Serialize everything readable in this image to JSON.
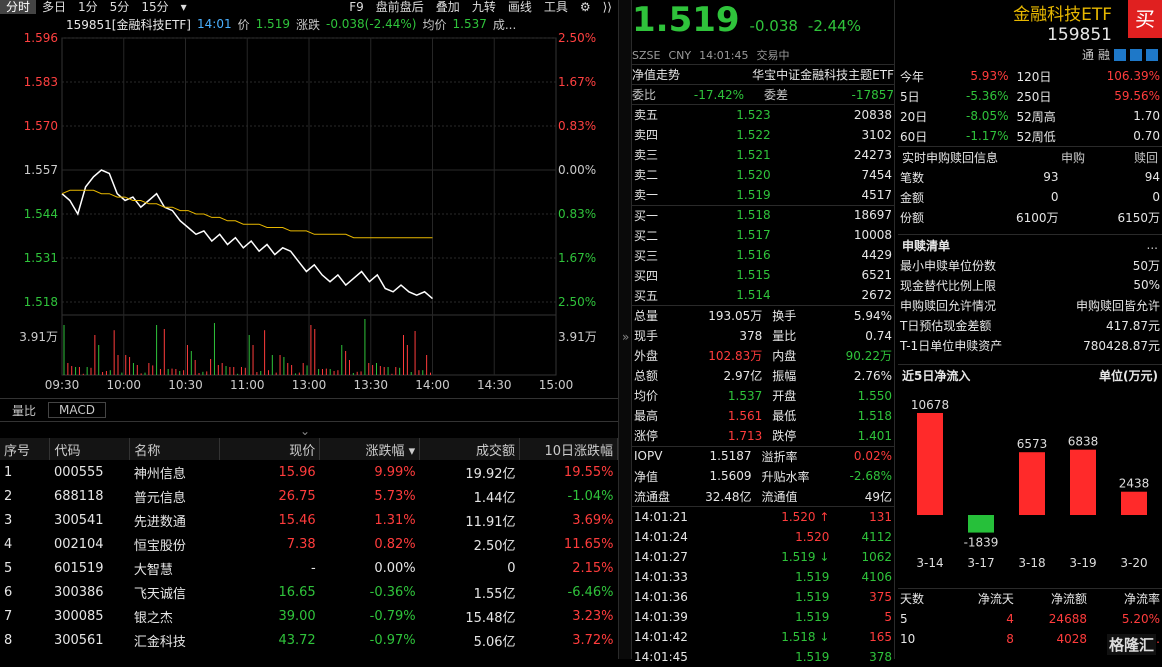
{
  "toolbar_left": [
    "分时",
    "多日",
    "1分",
    "5分",
    "15分",
    "▾"
  ],
  "toolbar_right": [
    "F9",
    "盘前盘后",
    "叠加",
    "九转",
    "画线",
    "工具",
    "⚙",
    "⟩⟩"
  ],
  "chart_header": {
    "name": "159851[金融科技ETF]",
    "time": "14:01",
    "price_label": "价",
    "price": "1.519",
    "chg_label": "涨跌",
    "chg": "-0.038(-2.44%)",
    "avg_label": "均价",
    "avg": "1.537",
    "vol_label": "成..."
  },
  "chart_data": {
    "type": "line",
    "x_ticks": [
      "09:30",
      "10:00",
      "10:30",
      "11:00",
      "13:00",
      "13:30",
      "14:00",
      "14:30",
      "15:00"
    ],
    "y_ticks": [
      "1.596",
      "1.583",
      "1.570",
      "1.557",
      "1.544",
      "1.531",
      "1.518"
    ],
    "y_pct_ticks": [
      "2.50%",
      "1.67%",
      "0.83%",
      "0.00%",
      "0.83%",
      "1.67%",
      "2.50%"
    ],
    "vol_tick": "3.91万",
    "vol_tick_right": "3.91万",
    "ylim": [
      1.518,
      1.596
    ],
    "series": [
      {
        "values": [
          1.55,
          1.548,
          1.544,
          1.552,
          1.555,
          1.557,
          1.556,
          1.55,
          1.548,
          1.549,
          1.546,
          1.548,
          1.55,
          1.546,
          1.545,
          1.542,
          1.54,
          1.538,
          1.539,
          1.536,
          1.538,
          1.535,
          1.537,
          1.534,
          1.536,
          1.533,
          1.535,
          1.532,
          1.534,
          1.533,
          1.53,
          1.527,
          1.529,
          1.526,
          1.524,
          1.526,
          1.523,
          1.525,
          1.527,
          1.524,
          1.526,
          1.522,
          1.521,
          1.523,
          1.521,
          1.52,
          1.521,
          1.519
        ]
      },
      {
        "values": [
          1.55,
          1.551,
          1.551,
          1.551,
          1.551,
          1.55,
          1.55,
          1.549,
          1.549,
          1.548,
          1.548,
          1.547,
          1.547,
          1.546,
          1.546,
          1.545,
          1.545,
          1.544,
          1.544,
          1.543,
          1.543,
          1.542,
          1.542,
          1.541,
          1.541,
          1.541,
          1.54,
          1.54,
          1.54,
          1.539,
          1.539,
          1.539,
          1.538,
          1.538,
          1.538,
          1.538,
          1.538,
          1.537,
          1.537,
          1.537,
          1.537,
          1.537,
          1.537,
          1.537,
          1.537,
          1.537,
          1.537,
          1.537
        ]
      }
    ]
  },
  "tabs_bottom": [
    "量比",
    "MACD"
  ],
  "table": {
    "headers": [
      "序号",
      "代码",
      "名称",
      "现价",
      "涨跌幅 ▾",
      "成交额",
      "10日涨跌幅"
    ],
    "rows": [
      [
        "1",
        "000555",
        "神州信息",
        "15.96",
        "9.99%",
        "19.92亿",
        "19.55%"
      ],
      [
        "2",
        "688118",
        "普元信息",
        "26.75",
        "5.73%",
        "1.44亿",
        "-1.04%"
      ],
      [
        "3",
        "300541",
        "先进数通",
        "15.46",
        "1.31%",
        "11.91亿",
        "3.69%"
      ],
      [
        "4",
        "002104",
        "恒宝股份",
        "7.38",
        "0.82%",
        "2.50亿",
        "11.65%"
      ],
      [
        "5",
        "601519",
        "大智慧",
        "-",
        "0.00%",
        "0",
        "2.15%"
      ],
      [
        "6",
        "300386",
        "飞天诚信",
        "16.65",
        "-0.36%",
        "1.55亿",
        "-6.46%"
      ],
      [
        "7",
        "300085",
        "银之杰",
        "39.00",
        "-0.79%",
        "15.48亿",
        "3.23%"
      ],
      [
        "8",
        "300561",
        "汇金科技",
        "43.72",
        "-0.97%",
        "5.06亿",
        "3.72%"
      ]
    ]
  },
  "quote": {
    "price": "1.519",
    "chg": "-0.038",
    "pct": "-2.44%",
    "name": "金融科技ETF",
    "code": "159851",
    "buy": "买",
    "exch": "SZSE",
    "cur": "CNY",
    "time": "14:01:45",
    "status": "交易中",
    "tong": "通",
    "rong": "融",
    "nav_label": "净值走势",
    "index_name": "华宝中证金融科技主题ETF"
  },
  "webi": {
    "l1": "委比",
    "v1": "-17.42%",
    "l2": "委差",
    "v2": "-17857"
  },
  "asks": [
    [
      "卖五",
      "1.523",
      "20838"
    ],
    [
      "卖四",
      "1.522",
      "3102"
    ],
    [
      "卖三",
      "1.521",
      "24273"
    ],
    [
      "卖二",
      "1.520",
      "7454"
    ],
    [
      "卖一",
      "1.519",
      "4517"
    ]
  ],
  "bids": [
    [
      "买一",
      "1.518",
      "18697"
    ],
    [
      "买二",
      "1.517",
      "10008"
    ],
    [
      "买三",
      "1.516",
      "4429"
    ],
    [
      "买四",
      "1.515",
      "6521"
    ],
    [
      "买五",
      "1.514",
      "2672"
    ]
  ],
  "stats": [
    [
      "总量",
      "193.05万",
      "换手",
      "5.94%"
    ],
    [
      "现手",
      "378",
      "量比",
      "0.74"
    ],
    [
      "外盘",
      "102.83万",
      "内盘",
      "90.22万"
    ],
    [
      "总额",
      "2.97亿",
      "振幅",
      "2.76%"
    ],
    [
      "均价",
      "1.537",
      "开盘",
      "1.550"
    ],
    [
      "最高",
      "1.561",
      "最低",
      "1.518"
    ],
    [
      "涨停",
      "1.713",
      "跌停",
      "1.401"
    ]
  ],
  "stats2": [
    [
      "IOPV",
      "1.5187",
      "溢折率",
      "0.02%"
    ],
    [
      "净值",
      "1.5609",
      "升贴水率",
      "-2.68%"
    ],
    [
      "流通盘",
      "32.48亿",
      "流通值",
      "49亿"
    ]
  ],
  "ticks": [
    [
      "14:01:21",
      "1.520",
      "↑",
      "131"
    ],
    [
      "14:01:24",
      "1.520",
      "",
      "4112"
    ],
    [
      "14:01:27",
      "1.519",
      "↓",
      "1062"
    ],
    [
      "14:01:33",
      "1.519",
      "",
      "4106"
    ],
    [
      "14:01:36",
      "1.519",
      "",
      "375"
    ],
    [
      "14:01:39",
      "1.519",
      "",
      "5"
    ],
    [
      "14:01:42",
      "1.518",
      "↓",
      "165"
    ],
    [
      "14:01:45",
      "1.519",
      "",
      "378"
    ]
  ],
  "perf": [
    [
      "今年",
      "5.93%",
      "120日",
      "106.39%"
    ],
    [
      "5日",
      "-5.36%",
      "250日",
      "59.56%"
    ],
    [
      "20日",
      "-8.05%",
      "52周高",
      "1.70"
    ],
    [
      "60日",
      "-1.17%",
      "52周低",
      "0.70"
    ]
  ],
  "sub": {
    "title": "实时申购赎回信息",
    "h1": "申购",
    "h2": "赎回",
    "rows": [
      [
        "笔数",
        "93",
        "94"
      ],
      [
        "金额",
        "0",
        "0"
      ],
      [
        "份额",
        "6100万",
        "6150万"
      ]
    ]
  },
  "plist": {
    "title": "申赎清单",
    "more": "...",
    "rows": [
      [
        "最小申赎单位份数",
        "50万"
      ],
      [
        "现金替代比例上限",
        "50%"
      ],
      [
        "申购赎回允许情况",
        "申购赎回皆允许"
      ],
      [
        "T日预估现金差额",
        "417.87元"
      ],
      [
        "T-1日单位申赎资产",
        "780428.87元"
      ]
    ]
  },
  "flow": {
    "title": "近5日净流入",
    "unit": "单位(万元)",
    "bars": [
      {
        "d": "3-14",
        "v": 10678
      },
      {
        "d": "3-17",
        "v": -1839
      },
      {
        "d": "3-18",
        "v": 6573
      },
      {
        "d": "3-19",
        "v": 6838
      },
      {
        "d": "3-20",
        "v": 2438
      }
    ]
  },
  "flow_table": {
    "headers": [
      "天数",
      "净流天",
      "净流额",
      "净流率"
    ],
    "rows": [
      [
        "5",
        "4",
        "24688",
        "5.20%"
      ],
      [
        "10",
        "8",
        "4028",
        "..."
      ]
    ]
  },
  "watermark": "格隆汇"
}
